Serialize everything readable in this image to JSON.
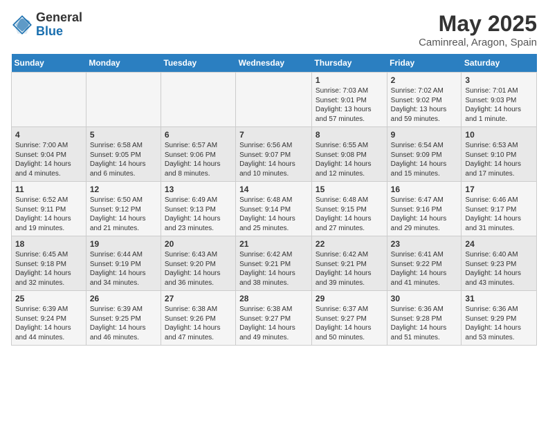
{
  "logo": {
    "general": "General",
    "blue": "Blue"
  },
  "title": "May 2025",
  "subtitle": "Caminreal, Aragon, Spain",
  "days_of_week": [
    "Sunday",
    "Monday",
    "Tuesday",
    "Wednesday",
    "Thursday",
    "Friday",
    "Saturday"
  ],
  "weeks": [
    [
      {
        "num": "",
        "info": ""
      },
      {
        "num": "",
        "info": ""
      },
      {
        "num": "",
        "info": ""
      },
      {
        "num": "",
        "info": ""
      },
      {
        "num": "1",
        "info": "Sunrise: 7:03 AM\nSunset: 9:01 PM\nDaylight: 13 hours\nand 57 minutes."
      },
      {
        "num": "2",
        "info": "Sunrise: 7:02 AM\nSunset: 9:02 PM\nDaylight: 13 hours\nand 59 minutes."
      },
      {
        "num": "3",
        "info": "Sunrise: 7:01 AM\nSunset: 9:03 PM\nDaylight: 14 hours\nand 1 minute."
      }
    ],
    [
      {
        "num": "4",
        "info": "Sunrise: 7:00 AM\nSunset: 9:04 PM\nDaylight: 14 hours\nand 4 minutes."
      },
      {
        "num": "5",
        "info": "Sunrise: 6:58 AM\nSunset: 9:05 PM\nDaylight: 14 hours\nand 6 minutes."
      },
      {
        "num": "6",
        "info": "Sunrise: 6:57 AM\nSunset: 9:06 PM\nDaylight: 14 hours\nand 8 minutes."
      },
      {
        "num": "7",
        "info": "Sunrise: 6:56 AM\nSunset: 9:07 PM\nDaylight: 14 hours\nand 10 minutes."
      },
      {
        "num": "8",
        "info": "Sunrise: 6:55 AM\nSunset: 9:08 PM\nDaylight: 14 hours\nand 12 minutes."
      },
      {
        "num": "9",
        "info": "Sunrise: 6:54 AM\nSunset: 9:09 PM\nDaylight: 14 hours\nand 15 minutes."
      },
      {
        "num": "10",
        "info": "Sunrise: 6:53 AM\nSunset: 9:10 PM\nDaylight: 14 hours\nand 17 minutes."
      }
    ],
    [
      {
        "num": "11",
        "info": "Sunrise: 6:52 AM\nSunset: 9:11 PM\nDaylight: 14 hours\nand 19 minutes."
      },
      {
        "num": "12",
        "info": "Sunrise: 6:50 AM\nSunset: 9:12 PM\nDaylight: 14 hours\nand 21 minutes."
      },
      {
        "num": "13",
        "info": "Sunrise: 6:49 AM\nSunset: 9:13 PM\nDaylight: 14 hours\nand 23 minutes."
      },
      {
        "num": "14",
        "info": "Sunrise: 6:48 AM\nSunset: 9:14 PM\nDaylight: 14 hours\nand 25 minutes."
      },
      {
        "num": "15",
        "info": "Sunrise: 6:48 AM\nSunset: 9:15 PM\nDaylight: 14 hours\nand 27 minutes."
      },
      {
        "num": "16",
        "info": "Sunrise: 6:47 AM\nSunset: 9:16 PM\nDaylight: 14 hours\nand 29 minutes."
      },
      {
        "num": "17",
        "info": "Sunrise: 6:46 AM\nSunset: 9:17 PM\nDaylight: 14 hours\nand 31 minutes."
      }
    ],
    [
      {
        "num": "18",
        "info": "Sunrise: 6:45 AM\nSunset: 9:18 PM\nDaylight: 14 hours\nand 32 minutes."
      },
      {
        "num": "19",
        "info": "Sunrise: 6:44 AM\nSunset: 9:19 PM\nDaylight: 14 hours\nand 34 minutes."
      },
      {
        "num": "20",
        "info": "Sunrise: 6:43 AM\nSunset: 9:20 PM\nDaylight: 14 hours\nand 36 minutes."
      },
      {
        "num": "21",
        "info": "Sunrise: 6:42 AM\nSunset: 9:21 PM\nDaylight: 14 hours\nand 38 minutes."
      },
      {
        "num": "22",
        "info": "Sunrise: 6:42 AM\nSunset: 9:21 PM\nDaylight: 14 hours\nand 39 minutes."
      },
      {
        "num": "23",
        "info": "Sunrise: 6:41 AM\nSunset: 9:22 PM\nDaylight: 14 hours\nand 41 minutes."
      },
      {
        "num": "24",
        "info": "Sunrise: 6:40 AM\nSunset: 9:23 PM\nDaylight: 14 hours\nand 43 minutes."
      }
    ],
    [
      {
        "num": "25",
        "info": "Sunrise: 6:39 AM\nSunset: 9:24 PM\nDaylight: 14 hours\nand 44 minutes."
      },
      {
        "num": "26",
        "info": "Sunrise: 6:39 AM\nSunset: 9:25 PM\nDaylight: 14 hours\nand 46 minutes."
      },
      {
        "num": "27",
        "info": "Sunrise: 6:38 AM\nSunset: 9:26 PM\nDaylight: 14 hours\nand 47 minutes."
      },
      {
        "num": "28",
        "info": "Sunrise: 6:38 AM\nSunset: 9:27 PM\nDaylight: 14 hours\nand 49 minutes."
      },
      {
        "num": "29",
        "info": "Sunrise: 6:37 AM\nSunset: 9:27 PM\nDaylight: 14 hours\nand 50 minutes."
      },
      {
        "num": "30",
        "info": "Sunrise: 6:36 AM\nSunset: 9:28 PM\nDaylight: 14 hours\nand 51 minutes."
      },
      {
        "num": "31",
        "info": "Sunrise: 6:36 AM\nSunset: 9:29 PM\nDaylight: 14 hours\nand 53 minutes."
      }
    ]
  ]
}
